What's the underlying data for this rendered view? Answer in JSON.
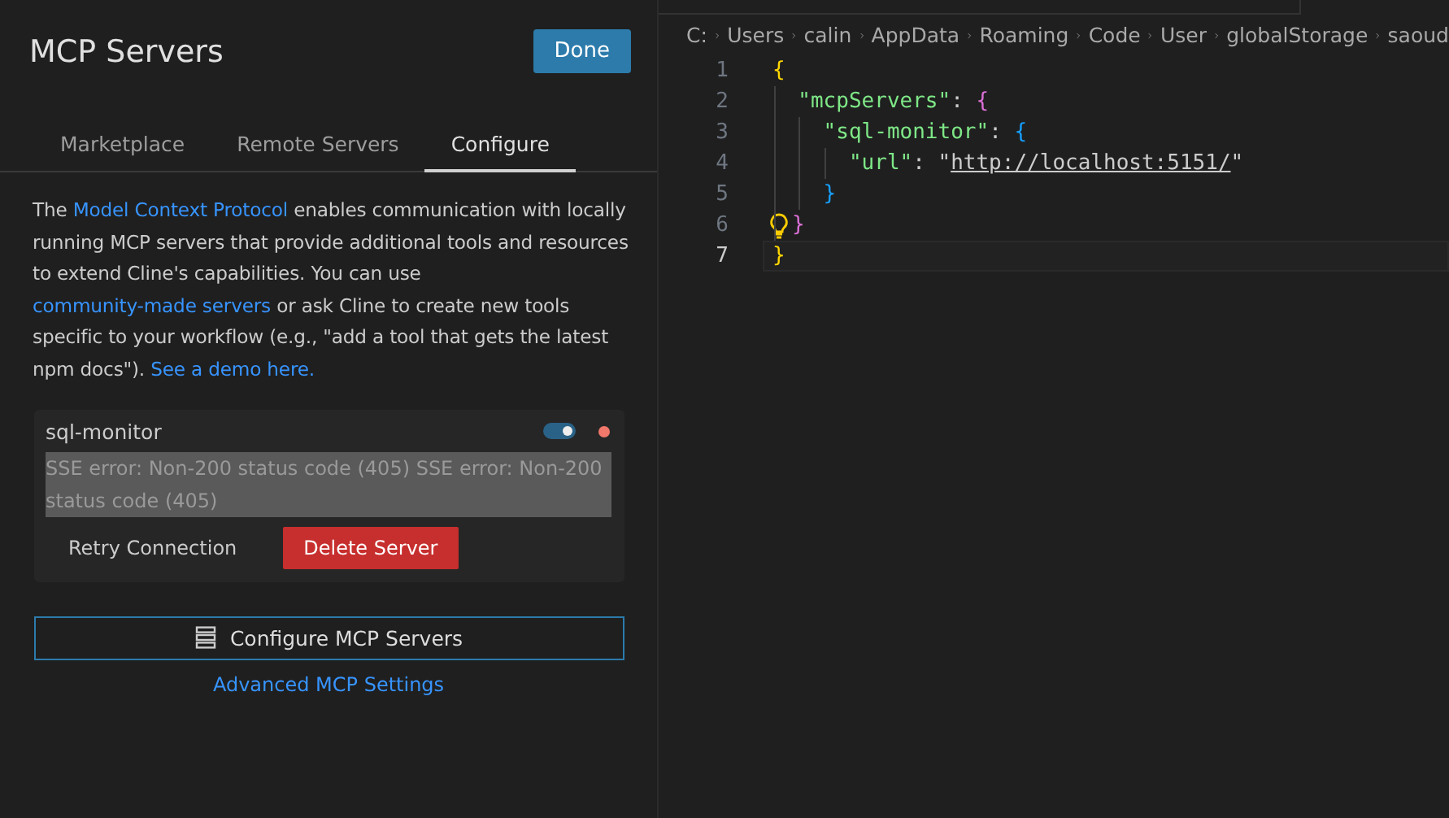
{
  "panel": {
    "title": "MCP Servers",
    "done_button": "Done",
    "tabs": [
      {
        "label": "Marketplace",
        "selected": false
      },
      {
        "label": "Remote Servers",
        "selected": false
      },
      {
        "label": "Configure",
        "selected": true
      }
    ],
    "intro": [
      {
        "kind": "text",
        "text": "The "
      },
      {
        "kind": "link",
        "text": "Model Context Protocol"
      },
      {
        "kind": "text",
        "text": " enables communication with locally running MCP servers that provide additional tools and resources to extend Cline's capabilities. You can use "
      },
      {
        "kind": "link",
        "text": "community-made servers"
      },
      {
        "kind": "text",
        "text": " or ask Cline to create new tools specific to your workflow (e.g., \"add a tool that gets the latest npm docs\"). "
      },
      {
        "kind": "link",
        "text": "See a demo here."
      }
    ],
    "servers": [
      {
        "name": "sql-monitor",
        "on": true,
        "color": "#f1786a",
        "error": "SSE error: Non-200 status code (405) SSE error: Non-200 status code (405)",
        "retry_button": "Retry Connection",
        "delete_button": "Delete Server"
      }
    ],
    "configure_button": "Configure MCP Servers",
    "advanced_link": "Advanced MCP Settings"
  },
  "editor": {
    "breadcrumbs": [
      "C:",
      "Users",
      "calin",
      "AppData",
      "Roaming",
      "Code",
      "User",
      "globalStorage",
      "saoud"
    ],
    "lines": [
      {
        "number": "1",
        "current": false,
        "lightbulb": false,
        "tokens": [
          {
            "kind": "brace1",
            "text": "{"
          }
        ]
      },
      {
        "number": "2",
        "current": false,
        "lightbulb": false,
        "tokens": [
          {
            "kind": "key",
            "text": "  \"mcpServers\""
          },
          {
            "kind": "punct",
            "text": ": "
          },
          {
            "kind": "brace2",
            "text": "{"
          }
        ]
      },
      {
        "number": "3",
        "current": false,
        "lightbulb": false,
        "tokens": [
          {
            "kind": "key",
            "text": "    \"sql-monitor\""
          },
          {
            "kind": "punct",
            "text": ": "
          },
          {
            "kind": "brace3",
            "text": "{"
          }
        ]
      },
      {
        "number": "4",
        "current": false,
        "lightbulb": false,
        "tokens": [
          {
            "kind": "key",
            "text": "      \"url\""
          },
          {
            "kind": "punct",
            "text": ": \""
          },
          {
            "kind": "link",
            "text": "http://localhost:5151/"
          },
          {
            "kind": "punct",
            "text": "\""
          }
        ]
      },
      {
        "number": "5",
        "current": false,
        "lightbulb": false,
        "tokens": [
          {
            "kind": "brace3",
            "text": "    }"
          }
        ]
      },
      {
        "number": "6",
        "current": false,
        "lightbulb": true,
        "tokens": [
          {
            "kind": "brace2",
            "text": "}"
          }
        ]
      },
      {
        "number": "7",
        "current": true,
        "lightbulb": false,
        "tokens": [
          {
            "kind": "brace1",
            "text": "}"
          }
        ]
      }
    ]
  }
}
